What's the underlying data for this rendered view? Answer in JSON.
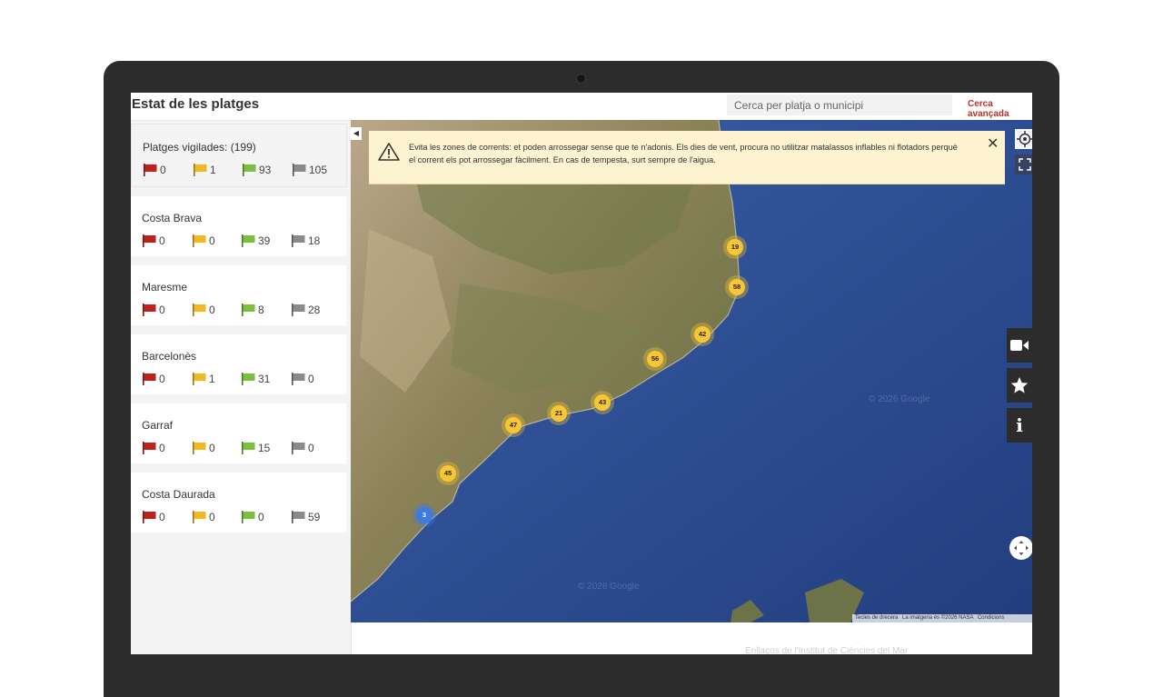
{
  "header": {
    "title": "Estat de les platges",
    "search_placeholder": "Cerca per platja o municipi",
    "advanced_search": "Cerca avançada"
  },
  "flag_colors": {
    "red": "#c0221b",
    "yellow": "#f2b81f",
    "green": "#7cbe3f",
    "gray": "#8a8a8a"
  },
  "summary": {
    "label": "Platges vigilades: (199)",
    "red": "0",
    "yellow": "1",
    "green": "93",
    "gray": "105"
  },
  "regions": [
    {
      "name": "Costa Brava",
      "red": "0",
      "yellow": "0",
      "green": "39",
      "gray": "18"
    },
    {
      "name": "Maresme",
      "red": "0",
      "yellow": "0",
      "green": "8",
      "gray": "28"
    },
    {
      "name": "Barcelonès",
      "red": "0",
      "yellow": "1",
      "green": "31",
      "gray": "0"
    },
    {
      "name": "Garraf",
      "red": "0",
      "yellow": "0",
      "green": "15",
      "gray": "0"
    },
    {
      "name": "Costa Daurada",
      "red": "0",
      "yellow": "0",
      "green": "0",
      "gray": "59"
    }
  ],
  "alert": {
    "text": "Evita les zones de corrents: et poden arrossegar sense que te n'adonis. Els dies de vent, procura no utilitzar matalassos inflables ni flotadors perquè el corrent els pot arrossegar fàcilment. En cas de tempesta, surt sempre de l'aigua.",
    "close": "✕"
  },
  "clusters": [
    "19",
    "58",
    "42",
    "56",
    "43",
    "21",
    "47",
    "45",
    "3"
  ],
  "map_attribution": {
    "shortcuts": "Tecles de drecera",
    "imagery": "La imatgeria és ©2026 NASA",
    "terms": "Condicions"
  },
  "watermarks": [
    "© 2026 Google",
    "© 2026 Google"
  ],
  "footer_text": "Enllaços de l'Institut de Ciències del Mar",
  "icons": {
    "alert": "warning-triangle-icon",
    "locate": "crosshair-icon",
    "fullscreen": "fullscreen-icon",
    "camera": "video-camera-icon",
    "favorites": "star-icon",
    "info": "info-icon",
    "pan": "pan-arrows-icon",
    "collapse": "chevron-left-icon"
  }
}
